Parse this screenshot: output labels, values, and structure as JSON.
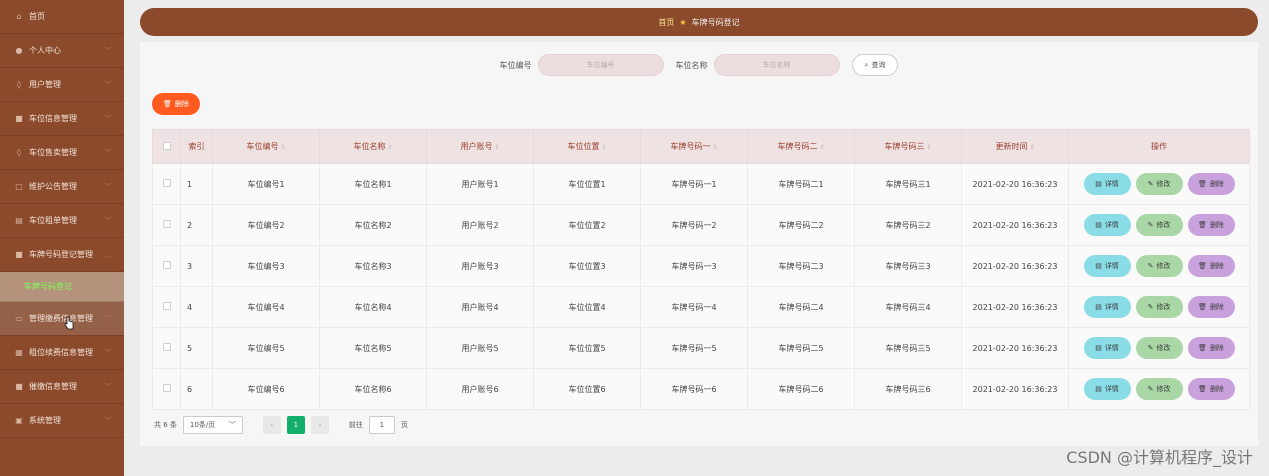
{
  "sidebar": {
    "items": [
      {
        "label": "首页",
        "icon": "home-icon"
      },
      {
        "label": "个人中心",
        "icon": "user-icon"
      },
      {
        "label": "用户管理",
        "icon": "location-icon"
      },
      {
        "label": "车位信息管理",
        "icon": "car-icon"
      },
      {
        "label": "车位售卖管理",
        "icon": "location-icon"
      },
      {
        "label": "维护公告管理",
        "icon": "folder-icon"
      },
      {
        "label": "车位租单管理",
        "icon": "list-icon"
      },
      {
        "label": "车牌号码登记管理",
        "icon": "car-icon"
      },
      {
        "label": "管理缴费信息管理",
        "icon": "card-icon"
      },
      {
        "label": "租位续费信息管理",
        "icon": "grid-icon"
      },
      {
        "label": "催缴信息管理",
        "icon": "car-icon"
      },
      {
        "label": "系统管理",
        "icon": "settings-icon"
      }
    ],
    "sub_item": "车牌号码登记"
  },
  "breadcrumb": {
    "home": "首页",
    "current": "车牌号码登记"
  },
  "search": {
    "label1": "车位编号",
    "placeholder1": "车位编号",
    "label2": "车位名称",
    "placeholder2": "车位名称",
    "button": "查询"
  },
  "toolbar": {
    "delete_label": "删除"
  },
  "table": {
    "headers": [
      "索引",
      "车位编号",
      "车位名称",
      "用户账号",
      "车位位置",
      "车牌号码一",
      "车牌号码二",
      "车牌号码三",
      "更新时间",
      "操作"
    ],
    "rows": [
      [
        "1",
        "车位编号1",
        "车位名称1",
        "用户账号1",
        "车位位置1",
        "车牌号码一1",
        "车牌号码二1",
        "车牌号码三1",
        "2021-02-20 16:36:23"
      ],
      [
        "2",
        "车位编号2",
        "车位名称2",
        "用户账号2",
        "车位位置2",
        "车牌号码一2",
        "车牌号码二2",
        "车牌号码三2",
        "2021-02-20 16:36:23"
      ],
      [
        "3",
        "车位编号3",
        "车位名称3",
        "用户账号3",
        "车位位置3",
        "车牌号码一3",
        "车牌号码二3",
        "车牌号码三3",
        "2021-02-20 16:36:23"
      ],
      [
        "4",
        "车位编号4",
        "车位名称4",
        "用户账号4",
        "车位位置4",
        "车牌号码一4",
        "车牌号码二4",
        "车牌号码三4",
        "2021-02-20 16:36:23"
      ],
      [
        "5",
        "车位编号5",
        "车位名称5",
        "用户账号5",
        "车位位置5",
        "车牌号码一5",
        "车牌号码二5",
        "车牌号码三5",
        "2021-02-20 16:36:23"
      ],
      [
        "6",
        "车位编号6",
        "车位名称6",
        "用户账号6",
        "车位位置6",
        "车牌号码一6",
        "车牌号码二6",
        "车牌号码三6",
        "2021-02-20 16:36:23"
      ]
    ],
    "actions": {
      "detail": "详情",
      "edit": "修改",
      "delete": "删除"
    }
  },
  "pagination": {
    "total": "共 6 条",
    "page_size": "10条/页",
    "current_page": "1",
    "goto_label": "前往",
    "goto_value": "1",
    "goto_suffix": "页"
  },
  "watermark": "CSDN @计算机程序_设计",
  "colors": {
    "sidebar": "#8b4a2b",
    "active_sub": "#7dff5a",
    "delete": "#ff5a1f",
    "detail": "#8adde6",
    "edit": "#a9d7a5",
    "remove": "#c9a2dd",
    "page_current": "#13b06b"
  }
}
